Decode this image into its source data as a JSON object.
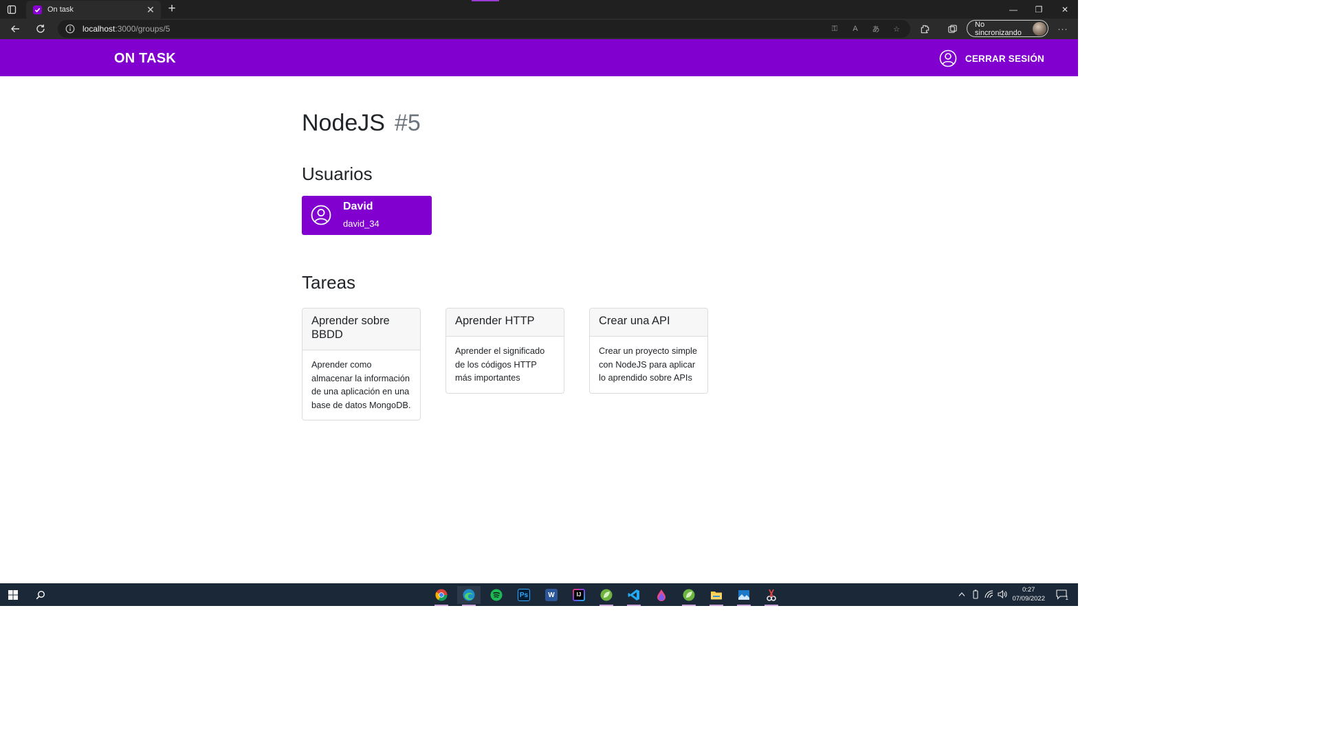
{
  "browser": {
    "tab_title": "On task",
    "tab_close": "✕",
    "new_tab": "+",
    "url_host": "localhost",
    "url_path": ":3000/groups/5",
    "profile_label": "No sincronizando",
    "window_controls": {
      "minimize": "—",
      "restore": "❐",
      "close": "✕"
    },
    "more_menu": "···"
  },
  "navbar": {
    "brand": "ON TASK",
    "logout_label": "CERRAR SESIÓN"
  },
  "group": {
    "name": "NodeJS",
    "id_label": "#5"
  },
  "users_section": {
    "heading": "Usuarios",
    "users": [
      {
        "name": "David",
        "username": "david_34"
      }
    ]
  },
  "tasks_section": {
    "heading": "Tareas",
    "tasks": [
      {
        "title": "Aprender sobre BBDD",
        "description": "Aprender como almacenar la información de una aplicación en una base de datos MongoDB."
      },
      {
        "title": "Aprender HTTP",
        "description": "Aprender el significado de los códigos HTTP más importantes"
      },
      {
        "title": "Crear una API",
        "description": "Crear un proyecto simple con NodeJS para aplicar lo aprendido sobre APIs"
      }
    ]
  },
  "taskbar": {
    "time": "0:27",
    "date": "07/09/2022",
    "notification_count": "1"
  },
  "colors": {
    "brand_purple": "#8100d0",
    "taskbar_bg": "#1b2838",
    "browser_dark": "#202020"
  }
}
